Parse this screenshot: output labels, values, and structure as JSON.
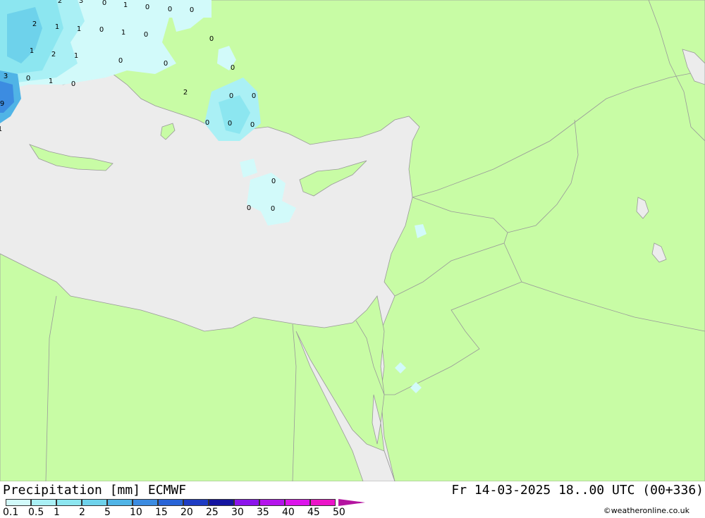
{
  "map": {
    "land_color": "#c8fca5",
    "sea_color": "#ececec",
    "border_color": "#999999",
    "value_labels": [
      "2",
      "3",
      "0",
      "1",
      "0",
      "0",
      "0",
      "2",
      "1",
      "1",
      "0",
      "1",
      "0",
      "0",
      "1",
      "2",
      "1",
      "0",
      "3",
      "0",
      "1",
      "0",
      "9",
      "1",
      "0",
      "0",
      "0",
      "0",
      "2",
      "0",
      "0",
      "0",
      "0",
      "0",
      "0"
    ]
  },
  "footer": {
    "title": "Precipitation [mm] ECMWF",
    "datetime": "Fr 14-03-2025 18..00 UTC (00+336)",
    "credit": "©weatheronline.co.uk"
  },
  "legend": {
    "labels": [
      "0.1",
      "0.5",
      "1",
      "2",
      "5",
      "10",
      "15",
      "20",
      "25",
      "30",
      "35",
      "40",
      "45",
      "50"
    ],
    "colors": [
      "#d2fafa",
      "#aaf0f5",
      "#8ce6f0",
      "#6ed2eb",
      "#50b4e6",
      "#3c8ce1",
      "#2864d7",
      "#1e3cc3",
      "#1414a0",
      "#8c14eb",
      "#b414eb",
      "#dc14eb",
      "#eb14c8",
      "#b414a0"
    ]
  }
}
